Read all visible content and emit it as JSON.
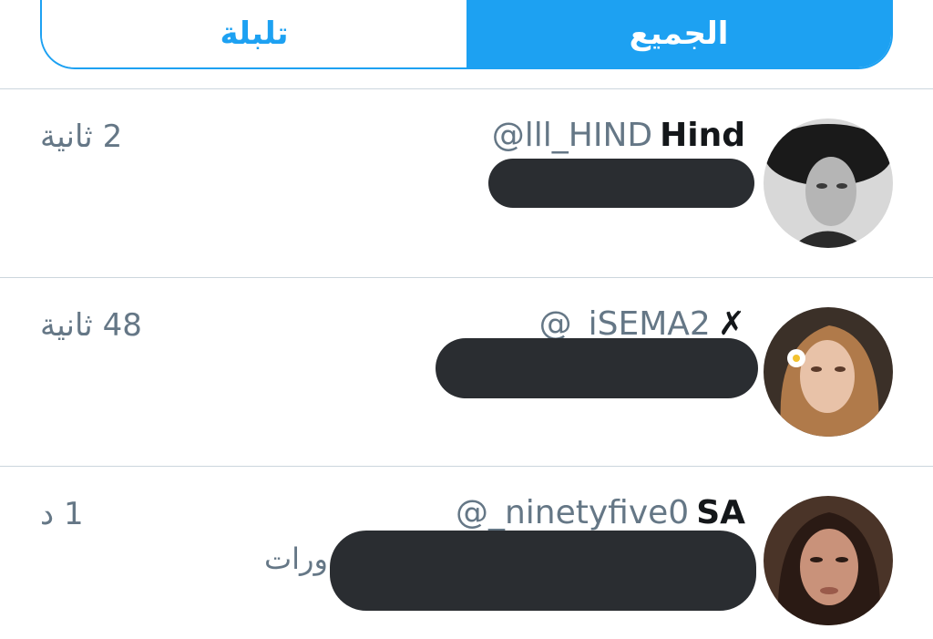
{
  "tabs": [
    {
      "label": "تلبلة",
      "active": false
    },
    {
      "label": "الجميع",
      "active": true
    }
  ],
  "colors": {
    "accent": "#1da1f2",
    "redaction": "#2a2d31",
    "secondary_text": "#657786"
  },
  "notifications": [
    {
      "display_name": "Hind",
      "handle": "@lll_HIND",
      "time": "2 ثانية",
      "avatar_icon": "user-avatar-icon"
    },
    {
      "display_name": "✗",
      "handle": "@_iSEMA2",
      "time": "48 ثانية",
      "avatar_icon": "user-avatar-icon"
    },
    {
      "display_name": "SA",
      "handle": "@_ninetyfive0",
      "time": "1 د",
      "snippet": "ورات",
      "avatar_icon": "user-avatar-icon"
    }
  ]
}
